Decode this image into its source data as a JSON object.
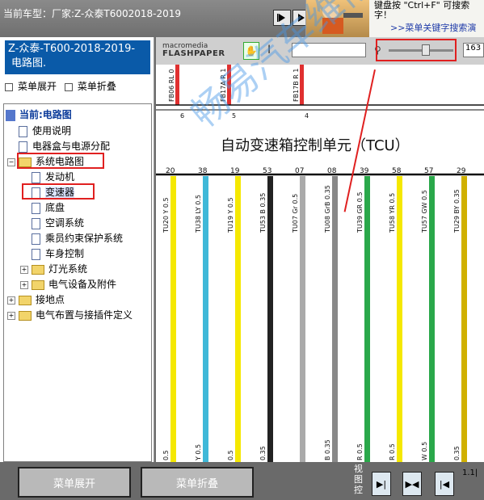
{
  "topbar": {
    "title": "当前车型：厂家:Z-众泰T6002018-2019"
  },
  "tip": {
    "line1": "键盘按 \"Ctrl+F\" 可搜索",
    "line2": "字！",
    "line3": ">>菜单关键字搜索演"
  },
  "left_header": {
    "line1": "Z-众泰-T600-2018-2019-",
    "line2": "电路图."
  },
  "expand_row": {
    "expand_label": "菜单展开",
    "collapse_label": "菜单折叠"
  },
  "tree": {
    "root": "当前:电路图",
    "items": [
      "使用说明",
      "电器盒与电源分配",
      "系统电路图",
      "发动机",
      "变速器",
      "底盘",
      "空调系统",
      "乘员约束保护系统",
      "车身控制",
      "灯光系统",
      "电气设备及附件",
      "接地点",
      "电气布置与接插件定义"
    ]
  },
  "viewer": {
    "brand_top": "macromedia",
    "brand_bottom": "FLASHPAPER",
    "zoom_value": "163",
    "zoom_level": 0.6
  },
  "diagram": {
    "title": "自动变速箱控制单元（TCU）",
    "top_wires": [
      {
        "label": "FB06 RL 0",
        "pin": "6",
        "color": "#e03030"
      },
      {
        "label": "FB17A R 1",
        "pin": "5",
        "color": "#e03030"
      },
      {
        "label": "FB17B R 1",
        "pin": "4",
        "color": "#e03030"
      }
    ],
    "pins": [
      {
        "pin": "20",
        "label": "TU20 Y 0.5",
        "bottom": "0.5",
        "color": "#f5e800"
      },
      {
        "pin": "38",
        "label": "TU38 LY 0.5",
        "bottom": "Y 0.5",
        "color": "#3fb8d8"
      },
      {
        "pin": "19",
        "label": "TU19 Y 0.5",
        "bottom": "0.5",
        "color": "#f5e800"
      },
      {
        "pin": "53",
        "label": "TU53 B 0.35",
        "bottom": "0.35",
        "color": "#222222"
      },
      {
        "pin": "07",
        "label": "TU07 Gr 0.5",
        "bottom": "",
        "color": "#aaaaaa"
      },
      {
        "pin": "08",
        "label": "TU08 GrB 0.35",
        "bottom": "B 0.35",
        "color": "#888888"
      },
      {
        "pin": "39",
        "label": "TU39 GR 0.5",
        "bottom": "R 0.5",
        "color": "#2aa84a"
      },
      {
        "pin": "58",
        "label": "TU58 YR 0.5",
        "bottom": "R 0.5",
        "color": "#f5e800"
      },
      {
        "pin": "57",
        "label": "TU57 GW 0.5",
        "bottom": "W 0.5",
        "color": "#2aa84a"
      },
      {
        "pin": "29",
        "label": "TU29 BY 0.35",
        "bottom": "0.35",
        "color": "#d0b000"
      }
    ],
    "watermark": "畅易汽车维修"
  },
  "bottombar": {
    "expand_label": "菜单展开",
    "collapse_label": "菜单折叠",
    "view_label": "视图控",
    "page_no": "1.1|"
  }
}
